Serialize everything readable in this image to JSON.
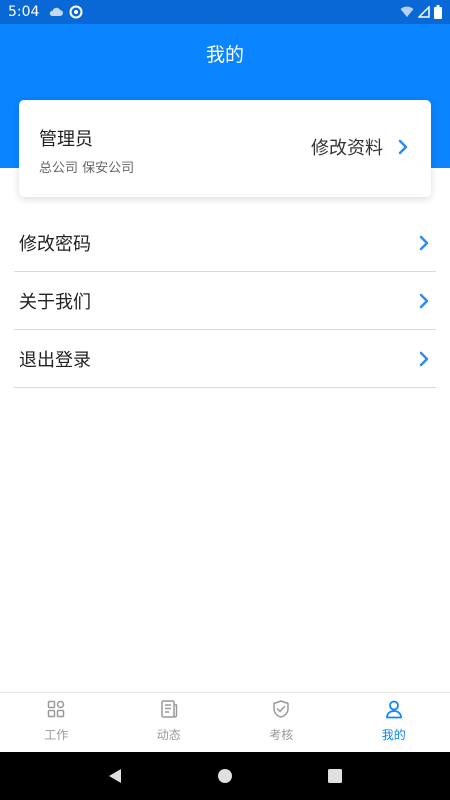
{
  "status_bar": {
    "time": "5:04",
    "icons_left": [
      "cloud-icon",
      "sync-icon"
    ],
    "icons_right": [
      "wifi-icon",
      "signal-icon",
      "battery-icon"
    ]
  },
  "header": {
    "title": "我的"
  },
  "profile": {
    "name": "管理员",
    "org": "总公司 保安公司",
    "edit_label": "修改资料"
  },
  "menu": [
    {
      "label": "修改密码"
    },
    {
      "label": "关于我们"
    },
    {
      "label": "退出登录"
    }
  ],
  "tabs": [
    {
      "label": "工作",
      "icon": "grid-icon",
      "active": false
    },
    {
      "label": "动态",
      "icon": "news-icon",
      "active": false
    },
    {
      "label": "考核",
      "icon": "shield-check-icon",
      "active": false
    },
    {
      "label": "我的",
      "icon": "user-icon",
      "active": true
    }
  ],
  "nav_buttons": [
    "back-icon",
    "home-icon",
    "recents-icon"
  ],
  "colors": {
    "primary": "#0a84ff",
    "status_bar": "#0a67d6",
    "chevron": "#2d8cf0",
    "tab_inactive": "#999999"
  }
}
